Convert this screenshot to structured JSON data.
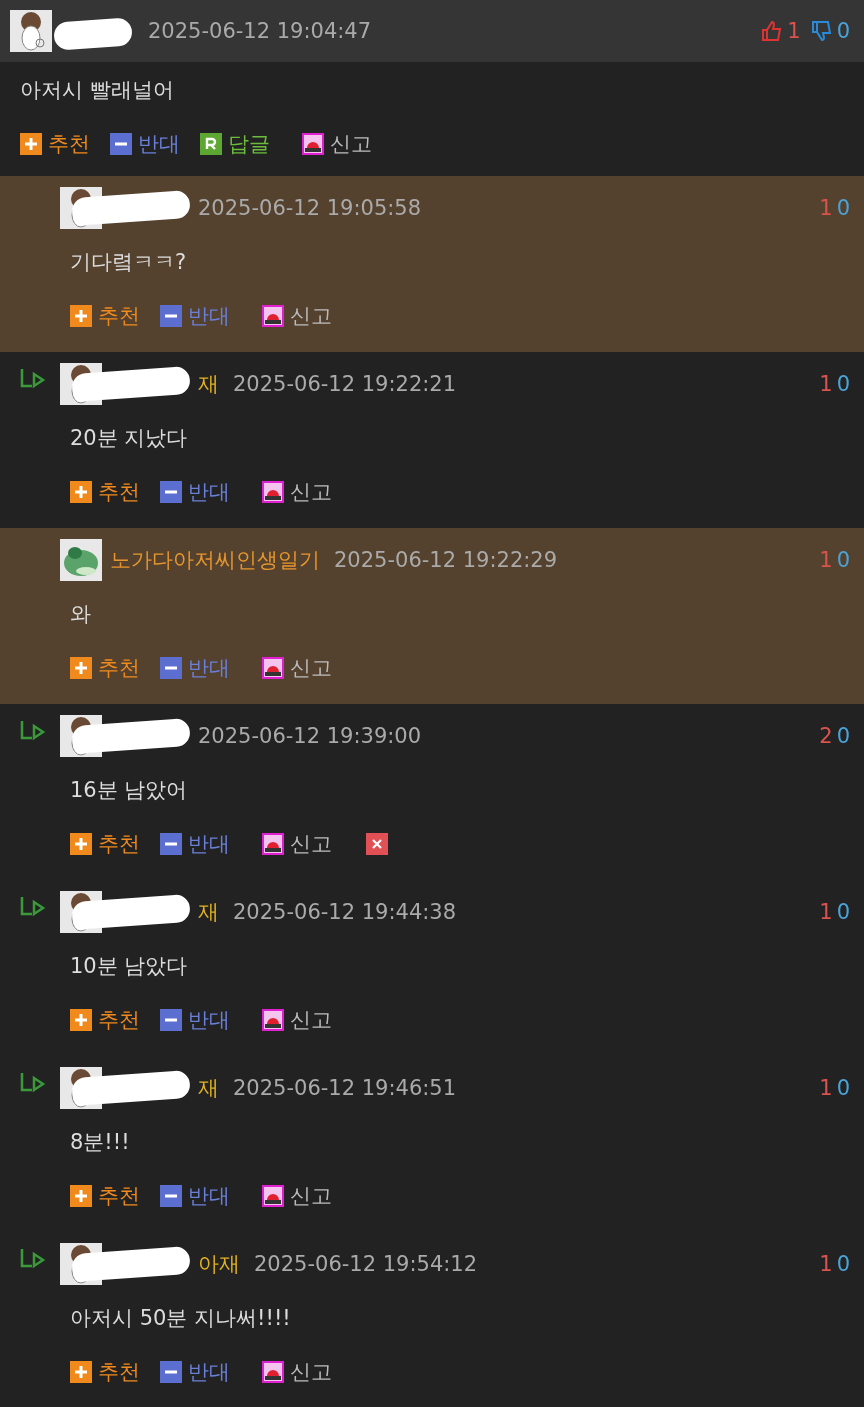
{
  "comments": [
    {
      "kind": "top",
      "highlighted": false,
      "redacted": true,
      "avatar": {
        "kind": "sketch"
      },
      "time": "2025-06-12 19:04:47",
      "up": "1",
      "down": "0",
      "text": "아저시 빨래널어",
      "actions": [
        {
          "kind": "up",
          "label": "추천"
        },
        {
          "kind": "down",
          "label": "반대"
        },
        {
          "kind": "reply",
          "label": "답글"
        },
        {
          "kind": "report",
          "label": "신고"
        }
      ]
    },
    {
      "kind": "reply",
      "highlighted": true,
      "redacted": true,
      "avatar": {
        "kind": "sketch"
      },
      "time": "2025-06-12 19:05:58",
      "up": "1",
      "down": "0",
      "text": "기다렼ㅋㅋ?",
      "actions": [
        {
          "kind": "up",
          "label": "추천"
        },
        {
          "kind": "down",
          "label": "반대"
        },
        {
          "kind": "report",
          "label": "신고"
        }
      ]
    },
    {
      "kind": "reply",
      "highlighted": false,
      "redacted": true,
      "name": "재",
      "avatar": {
        "kind": "sketch"
      },
      "time": "2025-06-12 19:22:21",
      "up": "1",
      "down": "0",
      "text": "20분 지났다",
      "actions": [
        {
          "kind": "up",
          "label": "추천"
        },
        {
          "kind": "down",
          "label": "반대"
        },
        {
          "kind": "report",
          "label": "신고"
        }
      ]
    },
    {
      "kind": "reply",
      "highlighted": true,
      "redacted": false,
      "name": "노가다아저씨인생일기",
      "avatar": {
        "kind": "green"
      },
      "time": "2025-06-12 19:22:29",
      "up": "1",
      "down": "0",
      "text": "와",
      "actions": [
        {
          "kind": "up",
          "label": "추천"
        },
        {
          "kind": "down",
          "label": "반대"
        },
        {
          "kind": "report",
          "label": "신고"
        }
      ]
    },
    {
      "kind": "reply",
      "highlighted": false,
      "redacted": true,
      "avatar": {
        "kind": "sketch"
      },
      "time": "2025-06-12 19:39:00",
      "up": "2",
      "down": "0",
      "text": "16분 남았어",
      "actions": [
        {
          "kind": "up",
          "label": "추천"
        },
        {
          "kind": "down",
          "label": "반대"
        },
        {
          "kind": "report",
          "label": "신고"
        },
        {
          "kind": "delete"
        }
      ]
    },
    {
      "kind": "reply",
      "highlighted": false,
      "redacted": true,
      "name": "재",
      "avatar": {
        "kind": "sketch"
      },
      "time": "2025-06-12 19:44:38",
      "up": "1",
      "down": "0",
      "text": "10분 남았다",
      "actions": [
        {
          "kind": "up",
          "label": "추천"
        },
        {
          "kind": "down",
          "label": "반대"
        },
        {
          "kind": "report",
          "label": "신고"
        }
      ]
    },
    {
      "kind": "reply",
      "highlighted": false,
      "redacted": true,
      "name": "재",
      "avatar": {
        "kind": "sketch"
      },
      "time": "2025-06-12 19:46:51",
      "up": "1",
      "down": "0",
      "text": "8분!!!",
      "actions": [
        {
          "kind": "up",
          "label": "추천"
        },
        {
          "kind": "down",
          "label": "반대"
        },
        {
          "kind": "report",
          "label": "신고"
        }
      ]
    },
    {
      "kind": "reply",
      "highlighted": false,
      "redacted": true,
      "name": "아재",
      "avatar": {
        "kind": "sketch"
      },
      "time": "2025-06-12 19:54:12",
      "up": "1",
      "down": "0",
      "text": "아저시 50분 지나써!!!!",
      "actions": [
        {
          "kind": "up",
          "label": "추천"
        },
        {
          "kind": "down",
          "label": "반대"
        },
        {
          "kind": "report",
          "label": "신고"
        }
      ]
    }
  ]
}
